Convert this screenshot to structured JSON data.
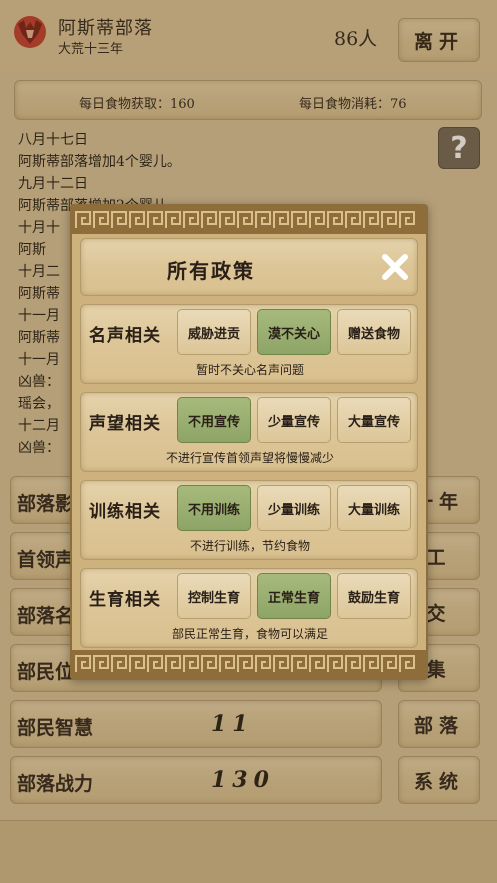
{
  "header": {
    "tribe_name": "阿斯蒂部落",
    "era": "大荒十三年",
    "population": "86人",
    "leave_label": "离开"
  },
  "food": {
    "gain": "每日食物获取：160",
    "cost": "每日食物消耗：76"
  },
  "help_label": "?",
  "log_lines": [
    "八月十七日",
    "阿斯蒂部落增加4个婴儿。",
    "九月十二日",
    "阿斯蒂部落增加2个婴儿。",
    "十月十",
    "阿斯",
    "十月二",
    "阿斯蒂",
    "十一月",
    "阿斯蒂",
    "十一月",
    "凶兽：",
    "瑶会，",
    "十二月",
    "凶兽："
  ],
  "stats": [
    {
      "label": "部落影",
      "value": ""
    },
    {
      "label": "首领声",
      "value": ""
    },
    {
      "label": "部落名",
      "value": ""
    },
    {
      "label": "部民位",
      "value": ""
    },
    {
      "label": "部民智慧",
      "value": "11"
    },
    {
      "label": "部落战力",
      "value": "130"
    }
  ],
  "side_buttons": [
    "一年",
    "工",
    "交",
    "集",
    "部落",
    "系统"
  ],
  "modal": {
    "title": "所有政策",
    "groups": [
      {
        "name": "名声相关",
        "options": [
          "威胁进贡",
          "漠不关心",
          "赠送食物"
        ],
        "selected": 1,
        "desc": "暂时不关心名声问题"
      },
      {
        "name": "声望相关",
        "options": [
          "不用宣传",
          "少量宣传",
          "大量宣传"
        ],
        "selected": 0,
        "desc": "不进行宣传首领声望将慢慢减少"
      },
      {
        "name": "训练相关",
        "options": [
          "不用训练",
          "少量训练",
          "大量训练"
        ],
        "selected": 0,
        "desc": "不进行训练，节约食物"
      },
      {
        "name": "生育相关",
        "options": [
          "控制生育",
          "正常生育",
          "鼓励生育"
        ],
        "selected": 1,
        "desc": "部民正常生育，食物可以满足"
      }
    ]
  },
  "colors": {
    "parchment": "#dcc597",
    "selected_option": "#9bb071",
    "frame": "#8f6d3a",
    "logo_red": "#c23a2a"
  }
}
